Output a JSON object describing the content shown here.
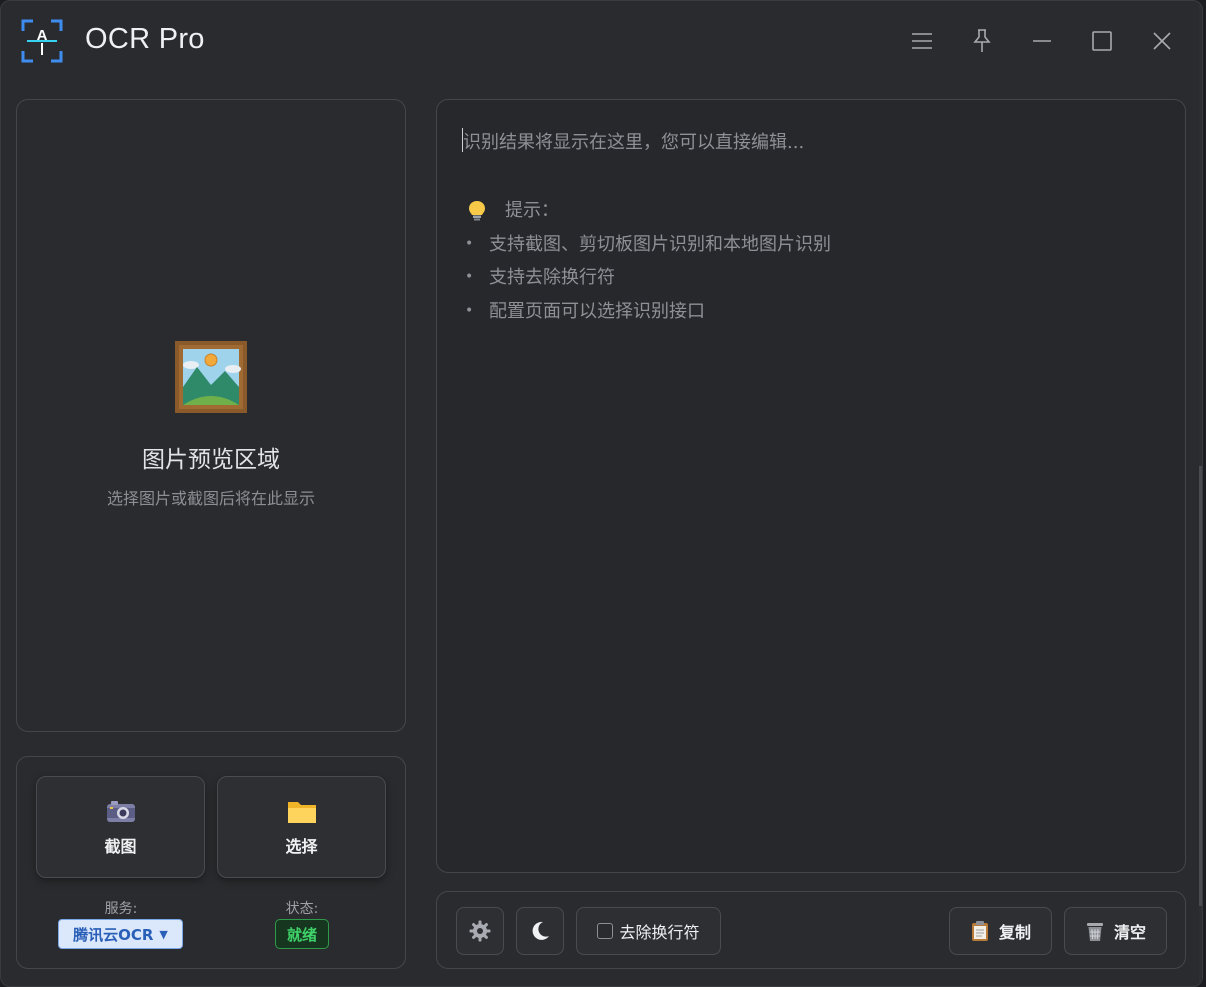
{
  "app": {
    "title": "OCR Pro"
  },
  "titlebar": {
    "buttons": [
      "menu-icon",
      "pin-icon",
      "minimize-icon",
      "maximize-icon",
      "close-icon"
    ]
  },
  "preview": {
    "title": "图片预览区域",
    "subtitle": "选择图片或截图后将在此显示"
  },
  "controls": {
    "screenshot_label": "截图",
    "select_label": "选择",
    "service_label": "服务:",
    "service_value": "腾讯云OCR",
    "status_label": "状态:",
    "status_value": "就绪"
  },
  "result": {
    "placeholder": "识别结果将显示在这里，您可以直接编辑...",
    "tips_heading": "提示：",
    "tips": [
      "支持截图、剪切板图片识别和本地图片识别",
      "支持去除换行符",
      "配置页面可以选择识别接口"
    ]
  },
  "toolbar": {
    "remove_newlines_label": "去除换行符",
    "remove_newlines_checked": false,
    "copy_label": "复制",
    "clear_label": "清空"
  },
  "colors": {
    "background": "#2a2b2e",
    "panel_border": "#45464b",
    "service_bg": "#dbe8fb",
    "service_text": "#2a5fb8",
    "status_green": "#3fd46a"
  }
}
